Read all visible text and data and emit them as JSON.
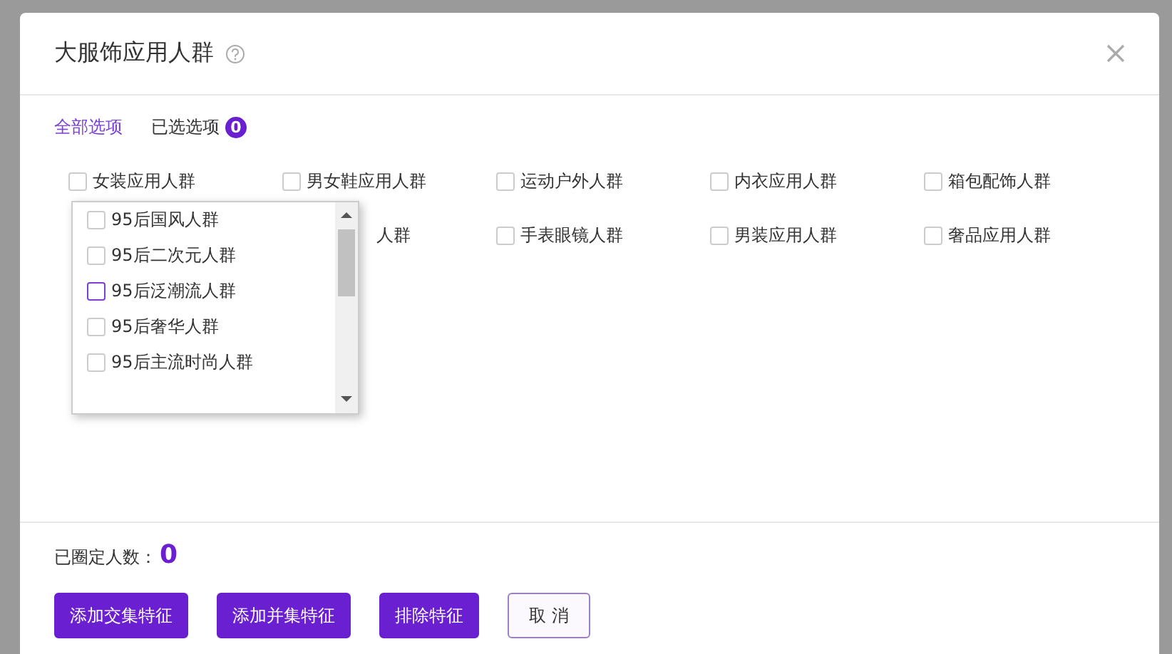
{
  "dialog": {
    "title": "大服饰应用人群",
    "tabs": [
      {
        "label": "全部选项",
        "selected": true
      },
      {
        "label": "已选选项",
        "selected": false,
        "badge": "0"
      }
    ],
    "option_rows": [
      {
        "covered_label": null,
        "options": [
          {
            "label": "女装应用人群",
            "checked": false
          },
          {
            "label": "男女鞋应用人群",
            "checked": false
          },
          {
            "label": "运动户外人群",
            "checked": false
          },
          {
            "label": "内衣应用人群",
            "checked": false
          },
          {
            "label": "箱包配饰人群",
            "checked": false
          }
        ]
      },
      {
        "covered_label": "人群",
        "options": [
          {
            "label": "手表眼镜人群",
            "checked": false
          },
          {
            "label": "男装应用人群",
            "checked": false
          },
          {
            "label": "奢品应用人群",
            "checked": false
          }
        ]
      }
    ],
    "dropdown": {
      "items": [
        {
          "label": "95后国风人群",
          "checked": false,
          "hovered": false
        },
        {
          "label": "95后二次元人群",
          "checked": false,
          "hovered": false
        },
        {
          "label": "95后泛潮流人群",
          "checked": false,
          "hovered": true
        },
        {
          "label": "95后奢华人群",
          "checked": false,
          "hovered": false
        },
        {
          "label": "95后主流时尚人群",
          "checked": false,
          "hovered": false
        }
      ]
    },
    "count_label": "已圈定人数：",
    "count_value": "0",
    "buttons": [
      {
        "label": "添加交集特征",
        "kind": "primary"
      },
      {
        "label": "添加并集特征",
        "kind": "primary"
      },
      {
        "label": "排除特征",
        "kind": "primary"
      },
      {
        "label": "取 消",
        "kind": "default"
      }
    ]
  }
}
